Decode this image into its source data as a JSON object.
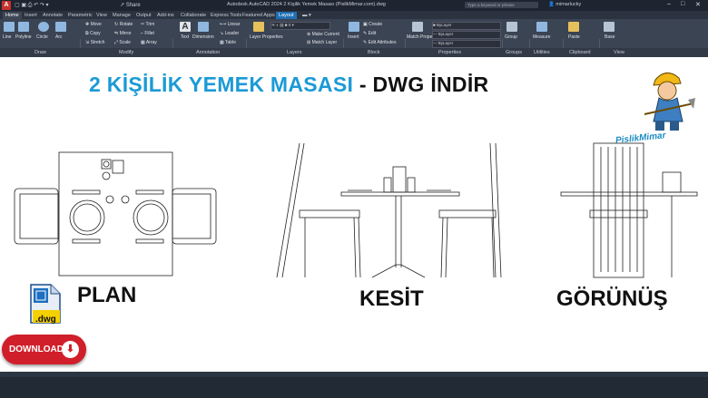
{
  "titlebar": {
    "app_letter": "A",
    "share": "Share",
    "title": "Autodesk AutoCAD 2024   2 Kişilik Yemek Masası (PislikMimar.com).dwg",
    "search_placeholder": "Type a keyword or phrase",
    "user": "mimarlucky"
  },
  "tabs": [
    "Home",
    "Insert",
    "Annotate",
    "Parametric",
    "View",
    "Manage",
    "Output",
    "Add-ins",
    "Collaborate",
    "Express Tools",
    "Featured Apps",
    "Layout"
  ],
  "ribbon": {
    "draw": [
      "Line",
      "Polyline",
      "Circle",
      "Arc"
    ],
    "modify": [
      "Move",
      "Rotate",
      "Trim",
      "Copy",
      "Mirror",
      "Fillet",
      "Stretch",
      "Scale",
      "Array"
    ],
    "annotation": [
      "Text",
      "Dimension",
      "Linear",
      "Leader",
      "Table"
    ],
    "layers": [
      "Layer Properties",
      "Make Current",
      "Match Layer"
    ],
    "block": [
      "Insert",
      "Create",
      "Edit",
      "Edit Attributes"
    ],
    "properties": [
      "Match Properties",
      "ByLayer",
      "ByLayer",
      "ByLayer"
    ],
    "groups": "Group",
    "utilities": "Measure",
    "clipboard": "Paste",
    "view": "Base"
  },
  "panels": [
    "Draw",
    "Modify",
    "Annotation",
    "Layers",
    "Block",
    "Properties",
    "Groups",
    "Utilities",
    "Clipboard",
    "View"
  ],
  "headline": {
    "main": "2 KİŞİLİK YEMEK MASASI",
    "dash": " - ",
    "tail": "DWG İNDİR"
  },
  "labels": {
    "plan": "PLAN",
    "kesit": "KESİT",
    "gorunus": "GÖRÜNÜŞ"
  },
  "brand": "PislikMimar",
  "file_ext": ".dwg",
  "download": "DOWNLOAD",
  "colors": {
    "headline": "#1c9ad6",
    "download": "#d01f2a",
    "ribbon": "#3b4453"
  }
}
